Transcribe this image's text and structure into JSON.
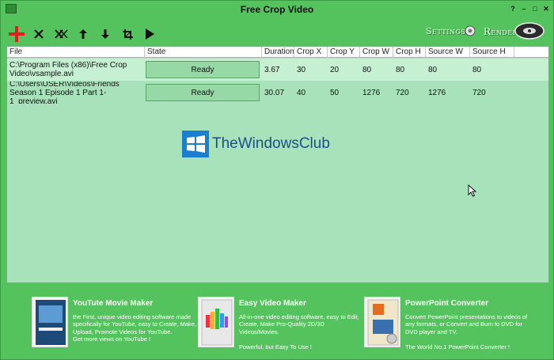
{
  "window": {
    "title": "Free Crop Video"
  },
  "toolbar": {
    "buttons": [
      {
        "name": "add-icon"
      },
      {
        "name": "remove-icon"
      },
      {
        "name": "remove-all-icon"
      },
      {
        "name": "move-up-icon"
      },
      {
        "name": "move-down-icon"
      },
      {
        "name": "crop-icon"
      },
      {
        "name": "play-icon"
      }
    ],
    "settings_label": "Settings",
    "render_label": "Render"
  },
  "table": {
    "columns": [
      "File",
      "State",
      "Duration",
      "Crop X",
      "Crop Y",
      "Crop W",
      "Crop H",
      "Source W",
      "Source H"
    ],
    "rows": [
      {
        "file": "C:\\Program Files (x86)\\Free Crop Video\\vsample.avi",
        "state": "Ready",
        "duration": "3.67",
        "crop_x": "30",
        "crop_y": "20",
        "crop_w": "80",
        "crop_h": "80",
        "source_w": "80",
        "source_h": "80"
      },
      {
        "file": "C:\\Users\\USER\\Videos\\Friends Season 1 Episode 1 Part 1-1_preview.avi",
        "state": "Ready",
        "duration": "30.07",
        "crop_x": "40",
        "crop_y": "50",
        "crop_w": "1276",
        "crop_h": "720",
        "source_w": "1276",
        "source_h": "720"
      }
    ]
  },
  "watermark": {
    "text": "TheWindowsClub"
  },
  "ads": [
    {
      "title": "YouTute Movie Maker",
      "desc": "the First, unique video editing software made specifically for YouTube, easy to Create, Make, Upload, Promote Videos for YouTube.",
      "tagline": "Get more views on YouTube !"
    },
    {
      "title": "Easy Video Maker",
      "desc": "All-in-one video editing software, easy to Edit, Create, Make Pro-Quality 2D/3D Videos/Movies.",
      "tagline": "Powerful, but Easy To Use !"
    },
    {
      "title": "PowerPoint Converter",
      "desc": "Convert PowerPoint presentations to videos of any formats, or Convert and Burn to DVD for DVD player and TV.",
      "tagline": "The World No.1 PowerPoint Converter !"
    }
  ],
  "colors": {
    "background": "#54c35d",
    "grid": "#a8e2ba",
    "row_selected": "#c5f0d2",
    "add_icon": "#e02020"
  }
}
